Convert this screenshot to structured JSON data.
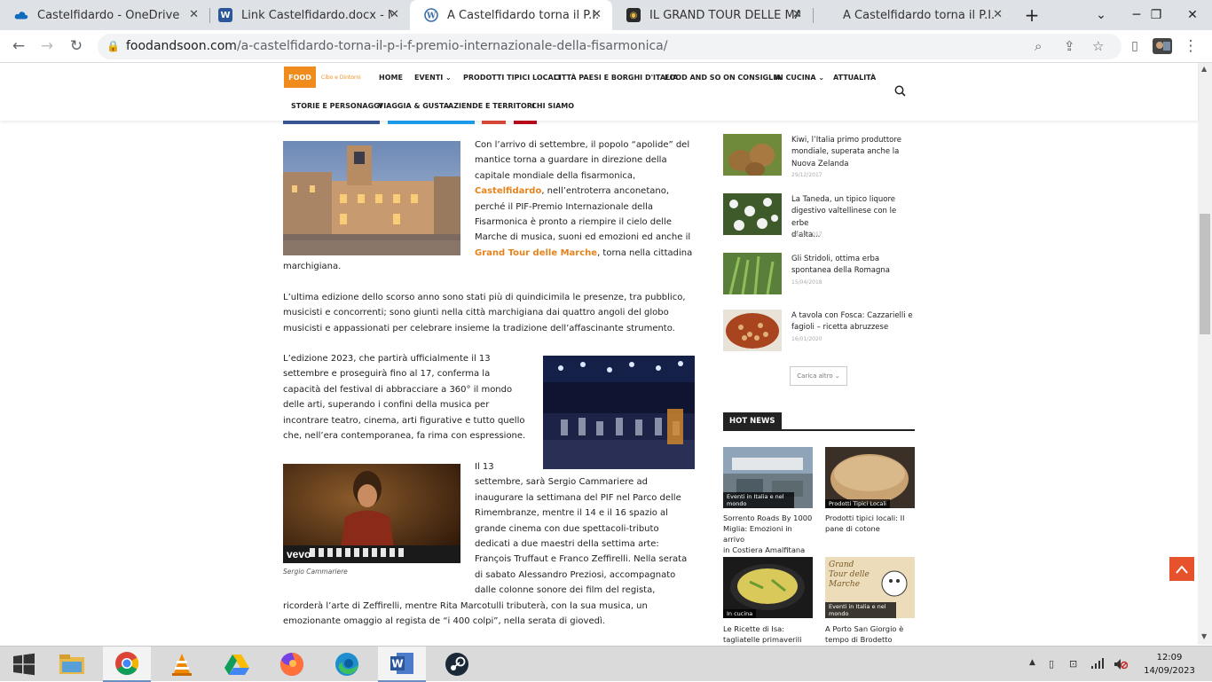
{
  "browser": {
    "tabs": [
      {
        "title": "Castelfidardo - OneDrive",
        "icon": "onedrive-icon"
      },
      {
        "title": "Link Castelfidardo.docx - Micro",
        "icon": "word-icon"
      },
      {
        "title": "A Castelfidardo torna il P.I.F. Pr",
        "icon": "wordpress-icon",
        "active": true
      },
      {
        "title": "IL GRAND TOUR DELLE MARCH",
        "icon": "site-icon"
      },
      {
        "title": "A Castelfidardo torna il P.I.F. Pr",
        "icon": "none"
      }
    ],
    "new_tab": "+",
    "url_host": "foodandsoon.com",
    "url_path": "/a-castelfidardo-torna-il-p-i-f-premio-internazionale-della-fisarmonica/"
  },
  "site": {
    "logo_text": "FOOD",
    "logo_sub": "Cibo e Dintorni",
    "menu_row1": [
      "HOME",
      "EVENTI ⌄",
      "PRODOTTI TIPICI LOCALI",
      "CITTÀ PAESI E BORGHI D'ITALIA",
      "FOOD AND SO ON CONSIGLIA",
      "IN CUCINA ⌄",
      "ATTUALITÀ"
    ],
    "menu_row2": [
      "STORIE E PERSONAGGI",
      "VIAGGIA & GUSTA",
      "AZIENDE E TERRITORI",
      "CHI SIAMO"
    ]
  },
  "article": {
    "p1_lines": [
      "Con l’arrivo di settembre, il popolo “apolide” del",
      "mantice torna a guardare in direzione della",
      "capitale mondiale della fisarmonica,"
    ],
    "p1_link1": "Castelfidardo",
    "p1_after_link1": ", nell’entroterra anconetano,",
    "p1_lines_b": [
      "perché il PIF-Premio Internazionale della",
      "Fisarmonica è pronto a riempire il cielo delle",
      "Marche di musica, suoni ed emozioni ed anche il"
    ],
    "p1_link2": "Grand Tour delle Marche",
    "p1_after_link2": ", torna nella cittadina",
    "p1_last": "marchigiana.",
    "p2_lines": [
      "L’ultima edizione dello scorso anno sono stati più di quindicimila le presenze, tra pubblico,",
      "musicisti e concorrenti; sono giunti nella città marchigiana dai quattro angoli del globo",
      "musicisti e appassionati per celebrare insieme la tradizione dell’affascinante strumento."
    ],
    "p3_lines": [
      "L’edizione 2023, che partirà ufficialmente il 13",
      "settembre e proseguirà fino al 17, conferma la",
      "capacità del festival di abbracciare a 360° il mondo",
      "delle arti, superando i confini della musica per",
      "incontrare teatro, cinema, arti figurative e tutto quello",
      "che, nell’era contemporanea, fa rima con espressione."
    ],
    "p4_lines_right": [
      "Il 13",
      "settembre, sarà Sergio Cammariere ad",
      "inaugurare la settimana del PIF nel Parco delle",
      "Rimembranze, mentre il 14 e il 16 spazio al",
      "grande cinema con due spettacoli-tributo",
      "dedicati a due maestri della settima arte:",
      "François Truffaut e Franco Zeffirelli. Nella serata",
      "di sabato Alessandro Preziosi, accompagnato",
      "dalle colonne sonore dei film del regista,"
    ],
    "p4_lines_full": [
      "ricorderà l’arte di Zeffirelli, mentre Rita Marcotulli tributerà, con la sua musica, un",
      "emozionante omaggio al regista de “i 400 colpi”, nella serata di giovedì."
    ],
    "video_logo": "vevo",
    "caption": "Sergio Cammariere"
  },
  "sidebar": {
    "items": [
      {
        "title_lines": [
          "Kiwi, l’Italia primo produttore",
          "mondiale, superata anche la",
          "Nuova Zelanda"
        ],
        "date": "29/12/2017"
      },
      {
        "title_lines": [
          "La Taneda, un tipico liquore",
          "digestivo valtellinese con le erbe",
          "d’alta..."
        ],
        "date": "18/12/2017"
      },
      {
        "title_lines": [
          "Gli Stridoli, ottima erba",
          "spontanea della Romagna"
        ],
        "date": "15/04/2018"
      },
      {
        "title_lines": [
          "A tavola con Fosca: Cazzarielli e",
          "fagioli – ricetta abruzzese"
        ],
        "date": "16/01/2020"
      }
    ],
    "load_more": "Carica altro ⌄",
    "hot_news_label": "HOT NEWS",
    "hot_news": [
      {
        "category": "Eventi in Italia e nel mondo",
        "title_lines": [
          "Sorrento Roads By 1000",
          "Miglia: Emozioni in arrivo",
          "in Costiera Amalfitana"
        ]
      },
      {
        "category": "Prodotti Tipici Locali",
        "title_lines": [
          "Prodotti tipici locali: Il",
          "pane di cotone"
        ]
      },
      {
        "category": "In cucina",
        "title_lines": [
          "Le Ricette di Isa:",
          "tagliatelle primaverili"
        ]
      },
      {
        "category": "Eventi in Italia e nel mondo",
        "title_lines": [
          "A Porto San Giorgio è",
          "tempo di Brodetto"
        ]
      }
    ],
    "hn4_overlay_text": "Grand Tour delle Marche"
  },
  "taskbar": {
    "time": "12:09",
    "date": "14/09/2023"
  },
  "colors": {
    "accent": "#e5831d",
    "tabstrip": "#dee1e6",
    "taskbar": "#dadada"
  }
}
